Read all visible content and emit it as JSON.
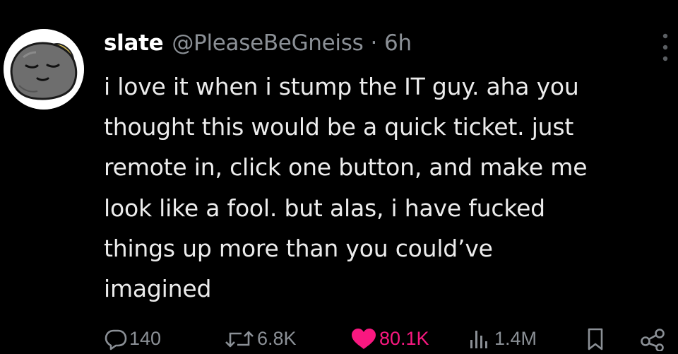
{
  "tweet": {
    "author": {
      "display_name": "slate",
      "handle": "@PleaseBeGneiss",
      "separator": "·",
      "time": "6h"
    },
    "text_lines": [
      "i love it when i stump the IT guy. aha you",
      "thought this would be a quick ticket. just",
      "remote in, click one button, and make me",
      "look like a fool. but alas, i have fucked",
      "things up more than you could’ve",
      "imagined"
    ],
    "stats": {
      "replies": "140",
      "retweets": "6.8K",
      "likes": "80.1K",
      "views": "1.4M"
    },
    "icons": {
      "avatar": "rock-character-avatar",
      "more": "more-options-icon",
      "reply": "reply-icon",
      "retweet": "retweet-icon",
      "like": "heart-icon",
      "views": "views-icon",
      "bookmark": "bookmark-icon",
      "share": "share-icon"
    },
    "colors": {
      "background": "#000000",
      "text": "#e7e9ea",
      "secondary": "#8b9096",
      "like": "#f91880"
    }
  }
}
